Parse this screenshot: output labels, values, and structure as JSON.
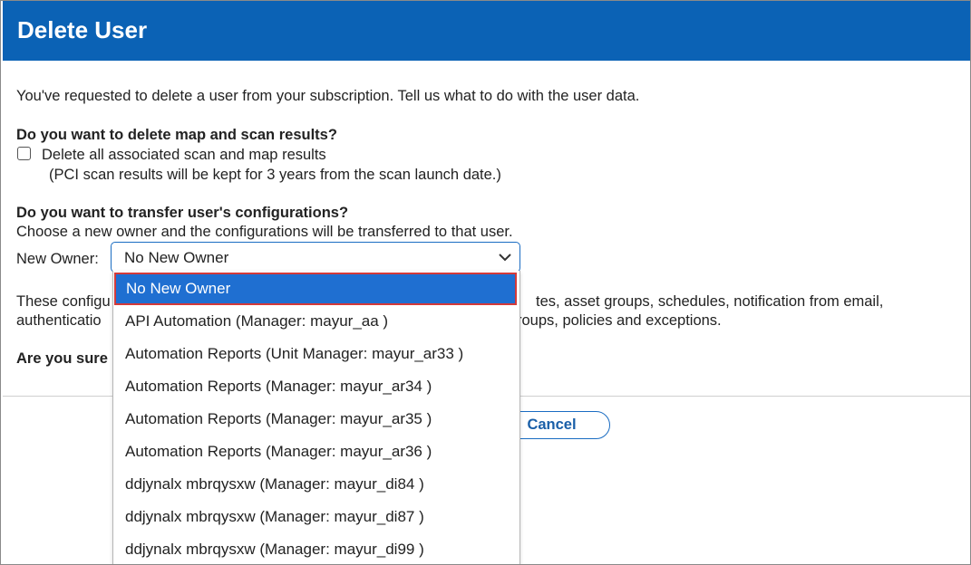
{
  "dialog": {
    "title": "Delete User",
    "intro": "You've requested to delete a user from your subscription. Tell us what to do with the user data.",
    "delete_section": {
      "heading": "Do you want to delete map and scan results?",
      "checkbox_label": "Delete all associated scan and map results",
      "checkbox_checked": false,
      "note": "(PCI scan results will be kept for 3 years from the scan launch date.)"
    },
    "transfer_section": {
      "heading": "Do you want to transfer user's configurations?",
      "description": "Choose a new owner and the configurations will be transferred to that user.",
      "owner_label": "New Owner:",
      "owner_value": "No New Owner"
    },
    "configs_text_line1_left": "These configu",
    "configs_text_line1_right": "tes, asset groups, schedules, notification from email,",
    "configs_text_line2_left": "authenticatio",
    "configs_text_line2_right": "roups, policies and exceptions.",
    "confirm_question_partial": "Are you sure",
    "cancel_label": "Cancel"
  },
  "dropdown": {
    "options": [
      "No New Owner",
      "API Automation (Manager: mayur_aa )",
      "Automation Reports (Unit Manager: mayur_ar33 )",
      "Automation Reports (Manager: mayur_ar34 )",
      "Automation Reports (Manager: mayur_ar35 )",
      "Automation Reports (Manager: mayur_ar36 )",
      "ddjynalx mbrqysxw (Manager: mayur_di84 )",
      "ddjynalx mbrqysxw (Manager: mayur_di87 )",
      "ddjynalx mbrqysxw (Manager: mayur_di99 )"
    ],
    "selected_index": 0
  },
  "colors": {
    "header_bg": "#0b62b5",
    "selected_option_bg": "#1f6fd1",
    "selected_option_border": "#d33a3a",
    "accent": "#1a6cc2"
  },
  "icons": {
    "select_arrow": "chevron-down-icon"
  }
}
